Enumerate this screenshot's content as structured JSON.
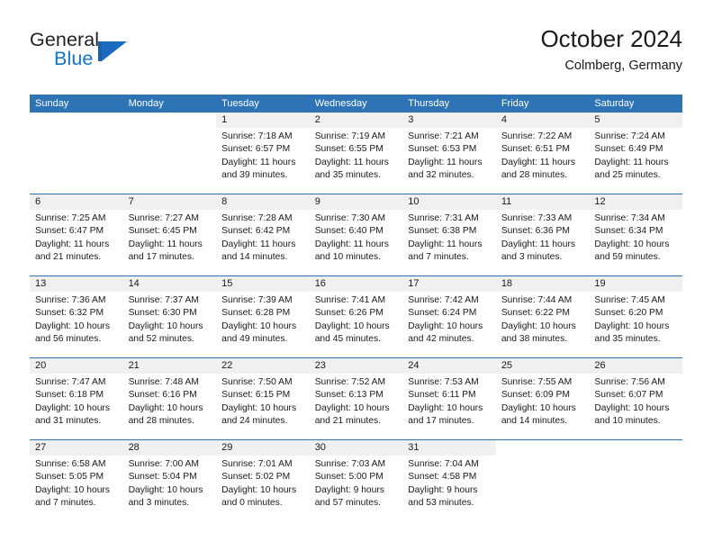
{
  "brand": {
    "name_part1": "General",
    "name_part2": "Blue",
    "flag_icon": "blue-flag-triangle-icon",
    "accent_color": "#1275c4"
  },
  "header": {
    "title": "October 2024",
    "subtitle": "Colmberg, Germany"
  },
  "theme": {
    "header_blue": "#2e74b5",
    "row_divider_blue": "#2e74b5",
    "daynum_band_gray": "#f0f0f0",
    "text_color": "#1a1a1a"
  },
  "calendar": {
    "weekdays": [
      "Sunday",
      "Monday",
      "Tuesday",
      "Wednesday",
      "Thursday",
      "Friday",
      "Saturday"
    ],
    "weeks": [
      [
        {
          "empty": true
        },
        {
          "empty": true
        },
        {
          "day": "1",
          "sunrise": "Sunrise: 7:18 AM",
          "sunset": "Sunset: 6:57 PM",
          "daylight": "Daylight: 11 hours and 39 minutes."
        },
        {
          "day": "2",
          "sunrise": "Sunrise: 7:19 AM",
          "sunset": "Sunset: 6:55 PM",
          "daylight": "Daylight: 11 hours and 35 minutes."
        },
        {
          "day": "3",
          "sunrise": "Sunrise: 7:21 AM",
          "sunset": "Sunset: 6:53 PM",
          "daylight": "Daylight: 11 hours and 32 minutes."
        },
        {
          "day": "4",
          "sunrise": "Sunrise: 7:22 AM",
          "sunset": "Sunset: 6:51 PM",
          "daylight": "Daylight: 11 hours and 28 minutes."
        },
        {
          "day": "5",
          "sunrise": "Sunrise: 7:24 AM",
          "sunset": "Sunset: 6:49 PM",
          "daylight": "Daylight: 11 hours and 25 minutes."
        }
      ],
      [
        {
          "day": "6",
          "sunrise": "Sunrise: 7:25 AM",
          "sunset": "Sunset: 6:47 PM",
          "daylight": "Daylight: 11 hours and 21 minutes."
        },
        {
          "day": "7",
          "sunrise": "Sunrise: 7:27 AM",
          "sunset": "Sunset: 6:45 PM",
          "daylight": "Daylight: 11 hours and 17 minutes."
        },
        {
          "day": "8",
          "sunrise": "Sunrise: 7:28 AM",
          "sunset": "Sunset: 6:42 PM",
          "daylight": "Daylight: 11 hours and 14 minutes."
        },
        {
          "day": "9",
          "sunrise": "Sunrise: 7:30 AM",
          "sunset": "Sunset: 6:40 PM",
          "daylight": "Daylight: 11 hours and 10 minutes."
        },
        {
          "day": "10",
          "sunrise": "Sunrise: 7:31 AM",
          "sunset": "Sunset: 6:38 PM",
          "daylight": "Daylight: 11 hours and 7 minutes."
        },
        {
          "day": "11",
          "sunrise": "Sunrise: 7:33 AM",
          "sunset": "Sunset: 6:36 PM",
          "daylight": "Daylight: 11 hours and 3 minutes."
        },
        {
          "day": "12",
          "sunrise": "Sunrise: 7:34 AM",
          "sunset": "Sunset: 6:34 PM",
          "daylight": "Daylight: 10 hours and 59 minutes."
        }
      ],
      [
        {
          "day": "13",
          "sunrise": "Sunrise: 7:36 AM",
          "sunset": "Sunset: 6:32 PM",
          "daylight": "Daylight: 10 hours and 56 minutes."
        },
        {
          "day": "14",
          "sunrise": "Sunrise: 7:37 AM",
          "sunset": "Sunset: 6:30 PM",
          "daylight": "Daylight: 10 hours and 52 minutes."
        },
        {
          "day": "15",
          "sunrise": "Sunrise: 7:39 AM",
          "sunset": "Sunset: 6:28 PM",
          "daylight": "Daylight: 10 hours and 49 minutes."
        },
        {
          "day": "16",
          "sunrise": "Sunrise: 7:41 AM",
          "sunset": "Sunset: 6:26 PM",
          "daylight": "Daylight: 10 hours and 45 minutes."
        },
        {
          "day": "17",
          "sunrise": "Sunrise: 7:42 AM",
          "sunset": "Sunset: 6:24 PM",
          "daylight": "Daylight: 10 hours and 42 minutes."
        },
        {
          "day": "18",
          "sunrise": "Sunrise: 7:44 AM",
          "sunset": "Sunset: 6:22 PM",
          "daylight": "Daylight: 10 hours and 38 minutes."
        },
        {
          "day": "19",
          "sunrise": "Sunrise: 7:45 AM",
          "sunset": "Sunset: 6:20 PM",
          "daylight": "Daylight: 10 hours and 35 minutes."
        }
      ],
      [
        {
          "day": "20",
          "sunrise": "Sunrise: 7:47 AM",
          "sunset": "Sunset: 6:18 PM",
          "daylight": "Daylight: 10 hours and 31 minutes."
        },
        {
          "day": "21",
          "sunrise": "Sunrise: 7:48 AM",
          "sunset": "Sunset: 6:16 PM",
          "daylight": "Daylight: 10 hours and 28 minutes."
        },
        {
          "day": "22",
          "sunrise": "Sunrise: 7:50 AM",
          "sunset": "Sunset: 6:15 PM",
          "daylight": "Daylight: 10 hours and 24 minutes."
        },
        {
          "day": "23",
          "sunrise": "Sunrise: 7:52 AM",
          "sunset": "Sunset: 6:13 PM",
          "daylight": "Daylight: 10 hours and 21 minutes."
        },
        {
          "day": "24",
          "sunrise": "Sunrise: 7:53 AM",
          "sunset": "Sunset: 6:11 PM",
          "daylight": "Daylight: 10 hours and 17 minutes."
        },
        {
          "day": "25",
          "sunrise": "Sunrise: 7:55 AM",
          "sunset": "Sunset: 6:09 PM",
          "daylight": "Daylight: 10 hours and 14 minutes."
        },
        {
          "day": "26",
          "sunrise": "Sunrise: 7:56 AM",
          "sunset": "Sunset: 6:07 PM",
          "daylight": "Daylight: 10 hours and 10 minutes."
        }
      ],
      [
        {
          "day": "27",
          "sunrise": "Sunrise: 6:58 AM",
          "sunset": "Sunset: 5:05 PM",
          "daylight": "Daylight: 10 hours and 7 minutes."
        },
        {
          "day": "28",
          "sunrise": "Sunrise: 7:00 AM",
          "sunset": "Sunset: 5:04 PM",
          "daylight": "Daylight: 10 hours and 3 minutes."
        },
        {
          "day": "29",
          "sunrise": "Sunrise: 7:01 AM",
          "sunset": "Sunset: 5:02 PM",
          "daylight": "Daylight: 10 hours and 0 minutes."
        },
        {
          "day": "30",
          "sunrise": "Sunrise: 7:03 AM",
          "sunset": "Sunset: 5:00 PM",
          "daylight": "Daylight: 9 hours and 57 minutes."
        },
        {
          "day": "31",
          "sunrise": "Sunrise: 7:04 AM",
          "sunset": "Sunset: 4:58 PM",
          "daylight": "Daylight: 9 hours and 53 minutes."
        },
        {
          "empty": true
        },
        {
          "empty": true
        }
      ]
    ]
  }
}
